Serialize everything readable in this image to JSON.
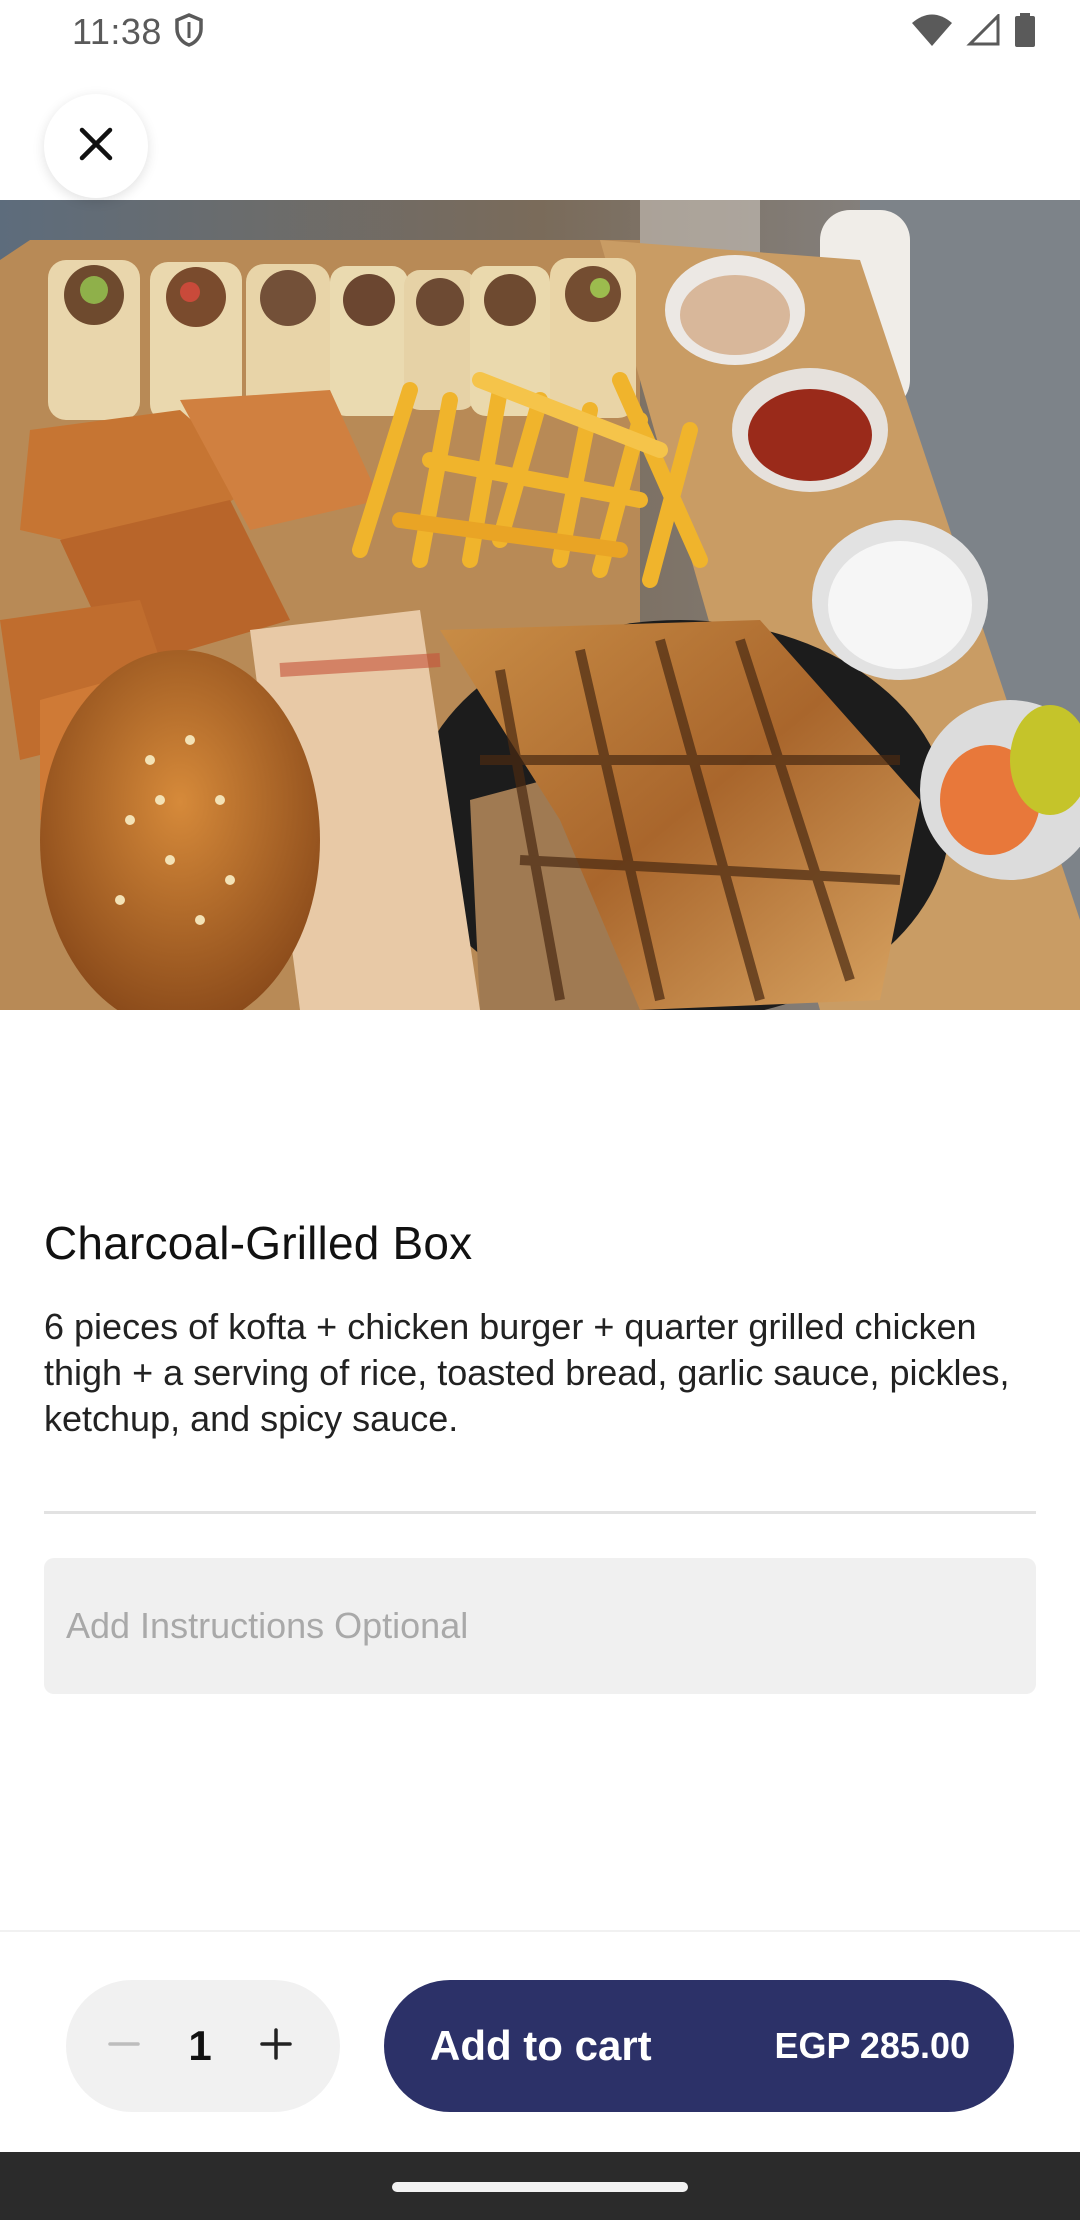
{
  "status_bar": {
    "time": "11:38",
    "icons": [
      "shield-icon",
      "wifi-icon",
      "signal-icon",
      "battery-icon"
    ]
  },
  "close_button": {
    "icon": "close-icon"
  },
  "hero_image": {
    "description_icon": "food-photo"
  },
  "product": {
    "title": "Charcoal-Grilled Box",
    "description": "6 pieces of kofta + chicken burger + quarter grilled chicken thigh + a serving of rice, toasted bread, garlic sauce, pickles, ketchup, and spicy sauce."
  },
  "instructions": {
    "placeholder": "Add Instructions Optional",
    "value": ""
  },
  "quantity": {
    "value": "1",
    "minus_icon": "minus-icon",
    "plus_icon": "plus-icon"
  },
  "cart": {
    "label": "Add to cart",
    "price": "EGP 285.00",
    "color": "#2c3168"
  }
}
